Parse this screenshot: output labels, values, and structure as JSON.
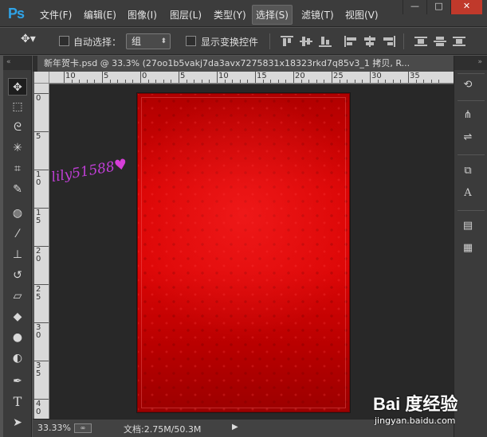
{
  "app": {
    "logo": "Ps"
  },
  "menu": {
    "items": [
      "文件(F)",
      "编辑(E)",
      "图像(I)",
      "图层(L)",
      "类型(Y)",
      "选择(S)",
      "滤镜(T)",
      "视图(V)"
    ],
    "active": "选择(S)"
  },
  "window_controls": {
    "minimize": "—",
    "maximize": "□",
    "close": "✕"
  },
  "options_bar": {
    "auto_select_label": "自动选择：",
    "auto_select_value": "组",
    "show_transform_label": "显示变换控件"
  },
  "document": {
    "tab_title": "新年贺卡.psd @ 33.3% (27oo1b5vakj7da3avx7275831x18323rkd7q85v3_1 拷贝, R..."
  },
  "rulers": {
    "horizontal_labels": [
      "10",
      "5",
      "0",
      "5",
      "10",
      "15",
      "20",
      "25",
      "30",
      "35"
    ],
    "vertical_labels": [
      "0",
      "5",
      "1\n0",
      "1\n5",
      "2\n0",
      "2\n5",
      "3\n0",
      "3\n5",
      "4\n0"
    ]
  },
  "canvas": {
    "overlay_text": "lily51588",
    "overlay_heart": "♥"
  },
  "status": {
    "zoom": "33.33%",
    "doc_info": "文档:2.75M/50.3M",
    "arrow": "▶"
  },
  "watermark": {
    "brand": "Bai 度经验",
    "site": "jingyan.baidu.com"
  },
  "toolbar": {
    "tools": [
      "move-tool",
      "marquee-tool",
      "lasso-tool",
      "magic-wand-tool",
      "crop-tool",
      "eyedropper-tool",
      "healing-brush-tool",
      "brush-tool",
      "clone-stamp-tool",
      "history-brush-tool",
      "eraser-tool",
      "paint-bucket-tool",
      "blur-tool",
      "dodge-tool",
      "pen-tool",
      "type-tool",
      "path-selection-tool"
    ]
  },
  "colors": {
    "accent": "#2fa3e7",
    "artboard_red": "#d90404",
    "watermark_purple": "#c23fd8"
  }
}
